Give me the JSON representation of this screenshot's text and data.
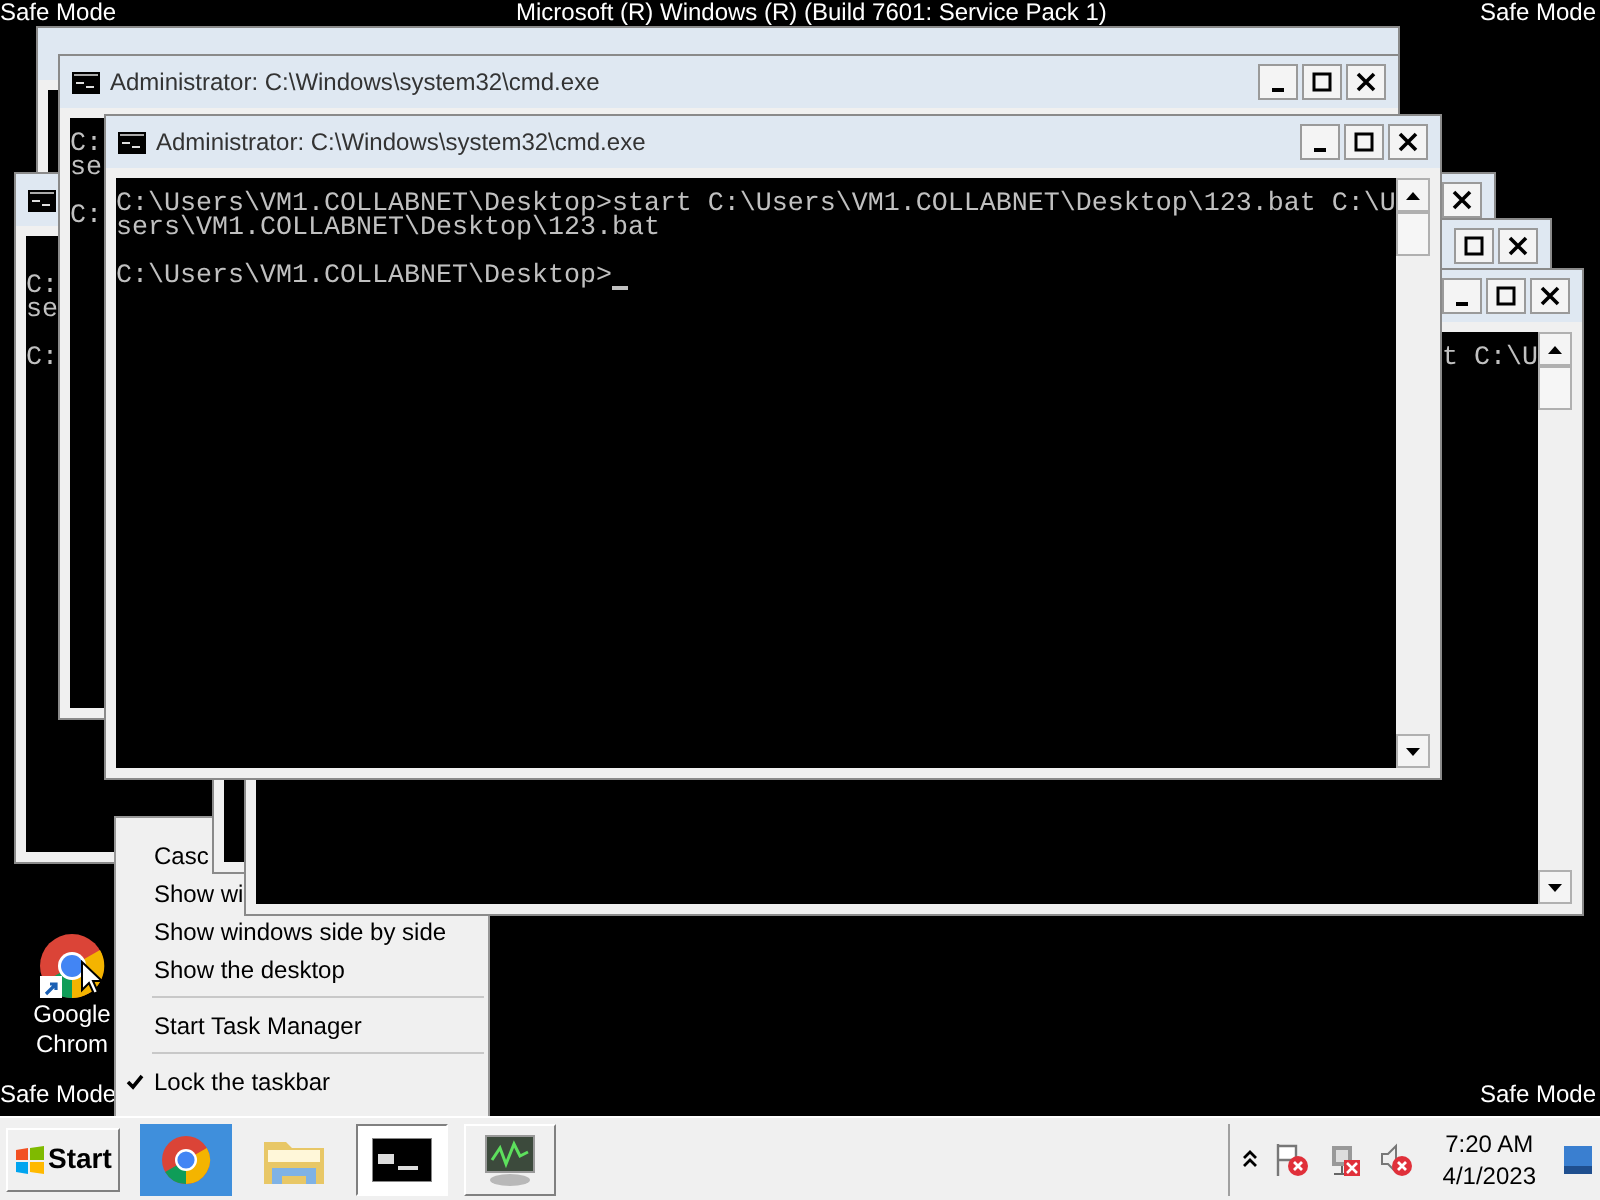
{
  "desktop": {
    "corner_labels": [
      "Safe Mode",
      "Safe Mode",
      "Safe Mode",
      "Safe Mode"
    ],
    "build_label": "Microsoft (R) Windows (R) (Build 7601: Service Pack 1)",
    "shortcut": {
      "label_lines": [
        "Google",
        "Chrom"
      ]
    }
  },
  "windows": [
    {
      "kind": "console_window"
    },
    {
      "kind": "console_window",
      "title": "Administrator: C:\\Windows\\system32\\cmd.exe",
      "lines": [
        {
          "kind": "text",
          "text": "C:"
        },
        {
          "kind": "text",
          "text": "se"
        },
        {
          "kind": "blank"
        },
        {
          "kind": "text",
          "text": "C:"
        }
      ]
    },
    {
      "kind": "console_window",
      "lines": [
        {
          "kind": "blank"
        },
        {
          "kind": "text",
          "text": "C:"
        },
        {
          "kind": "text",
          "text": "se"
        },
        {
          "kind": "blank"
        },
        {
          "kind": "text",
          "text": "C:"
        }
      ]
    },
    {
      "kind": "console_window"
    },
    {
      "kind": "console_window",
      "lines": [
        {
          "kind": "text",
          "text": "t C:\\U"
        }
      ]
    },
    {
      "kind": "console_window",
      "title": "Administrator: C:\\Windows\\system32\\cmd.exe",
      "lines": [
        {
          "kind": "text",
          "text": "C:\\Users\\VM1.COLLABNET\\Desktop>start C:\\Users\\VM1.COLLABNET\\Desktop\\123.bat C:\\U"
        },
        {
          "kind": "text",
          "text": "sers\\VM1.COLLABNET\\Desktop\\123.bat"
        },
        {
          "kind": "blank"
        },
        {
          "kind": "text",
          "text": "C:\\Users\\VM1.COLLABNET\\Desktop>"
        }
      ],
      "cursor": true
    }
  ],
  "context_menu": [
    {
      "kind": "item",
      "label": "Casc",
      "checked": false
    },
    {
      "kind": "item",
      "label": "Show wi",
      "checked": false
    },
    {
      "kind": "item",
      "label": "Show windows side by side",
      "checked": false
    },
    {
      "kind": "item",
      "label": "Show the desktop",
      "checked": false
    },
    {
      "kind": "separator"
    },
    {
      "kind": "item",
      "label": "Start Task Manager",
      "checked": false
    },
    {
      "kind": "separator"
    },
    {
      "kind": "item",
      "label": "Lock the taskbar",
      "checked": true
    }
  ],
  "taskbar": {
    "start_label": "Start",
    "apps": [
      {
        "kind": "browser",
        "selected": false
      },
      {
        "kind": "folder",
        "selected": false
      },
      {
        "kind": "console",
        "selected": true
      },
      {
        "kind": "monitor",
        "selected": false
      }
    ],
    "clock": {
      "time": "7:20 AM",
      "date": "4/1/2023"
    }
  }
}
